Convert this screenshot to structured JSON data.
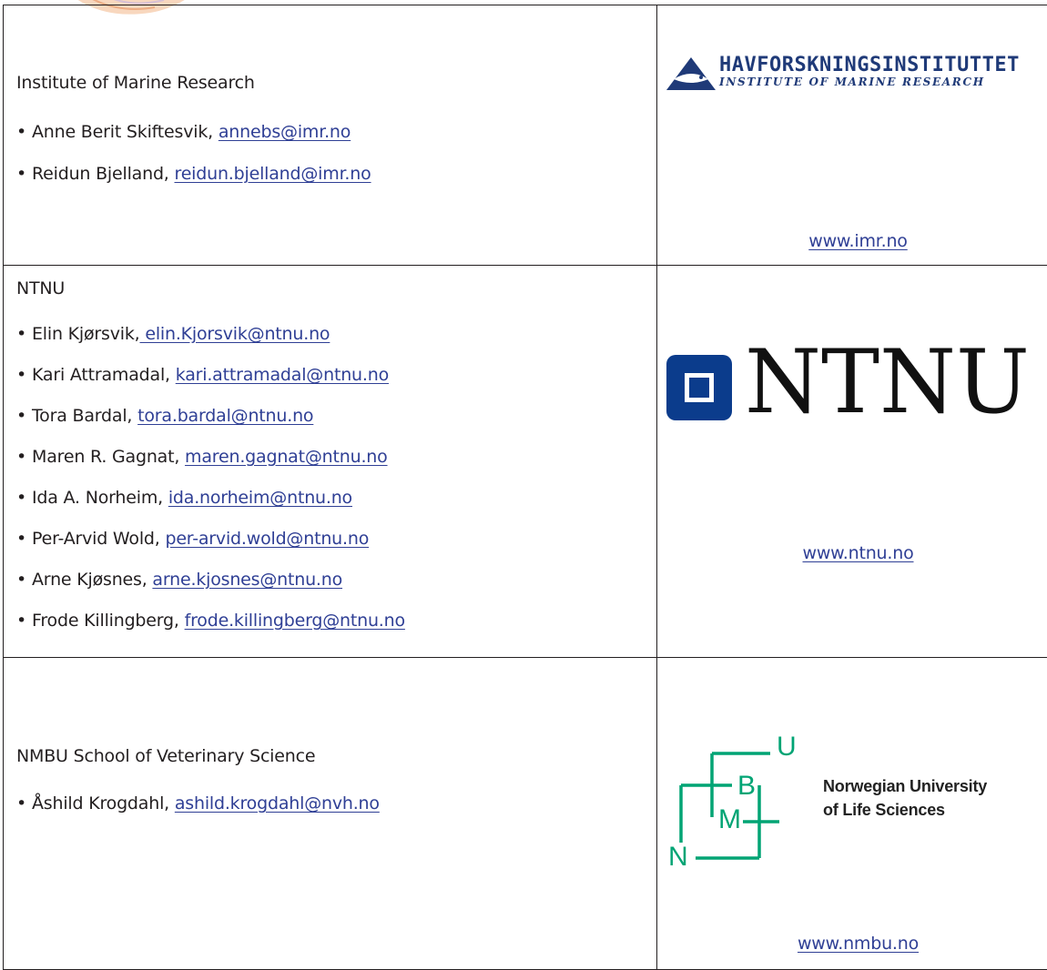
{
  "partners": [
    {
      "name": "Institute of Marine Research",
      "people": [
        {
          "name": "Anne Berit Skiftesvik, ",
          "email": "annebs@imr.no"
        },
        {
          "name": "Reidun Bjelland, ",
          "email": "reidun.bjelland@imr.no"
        }
      ],
      "logo": {
        "title": "HAVFORSKNINGSINSTITUTTET",
        "subtitle": "INSTITUTE OF MARINE RESEARCH"
      },
      "website": "www.imr.no"
    },
    {
      "name": "NTNU",
      "people": [
        {
          "name": "Elin Kjørsvik,",
          "email": " elin.Kjorsvik@ntnu.no"
        },
        {
          "name": "Kari Attramadal, ",
          "email": "kari.attramadal@ntnu.no"
        },
        {
          "name": "Tora Bardal, ",
          "email": "tora.bardal@ntnu.no"
        },
        {
          "name": "Maren R. Gagnat, ",
          "email": "maren.gagnat@ntnu.no"
        },
        {
          "name": "Ida A. Norheim, ",
          "email": "ida.norheim@ntnu.no"
        },
        {
          "name": "Per-Arvid Wold, ",
          "email": "per-arvid.wold@ntnu.no"
        },
        {
          "name": "Arne Kjøsnes, ",
          "email": "arne.kjosnes@ntnu.no"
        },
        {
          "name": "Frode Killingberg, ",
          "email": "frode.killingberg@ntnu.no"
        }
      ],
      "logo": {
        "wordmark": "NTNU"
      },
      "website": "www.ntnu.no"
    },
    {
      "name": "NMBU School of Veterinary Science",
      "people": [
        {
          "name": "Åshild Krogdahl, ",
          "email": "ashild.krogdahl@nvh.no"
        }
      ],
      "logo": {
        "letters": [
          "U",
          "B",
          "M",
          "N"
        ],
        "line1": "Norwegian University",
        "line2": "of Life Sciences"
      },
      "website": "www.nmbu.no"
    }
  ],
  "bullet": "•",
  "colors": {
    "link": "#2f3f95",
    "text": "#231f20",
    "ntnu_blue": "#0b3c8c",
    "nmbu_green": "#00a474",
    "imr_blue": "#1f3a78"
  },
  "icons": {
    "imr_logo": "imr-fish-triangle-icon",
    "ntnu_logo": "ntnu-square-icon",
    "decor": "fish-fin-decoration-icon"
  }
}
